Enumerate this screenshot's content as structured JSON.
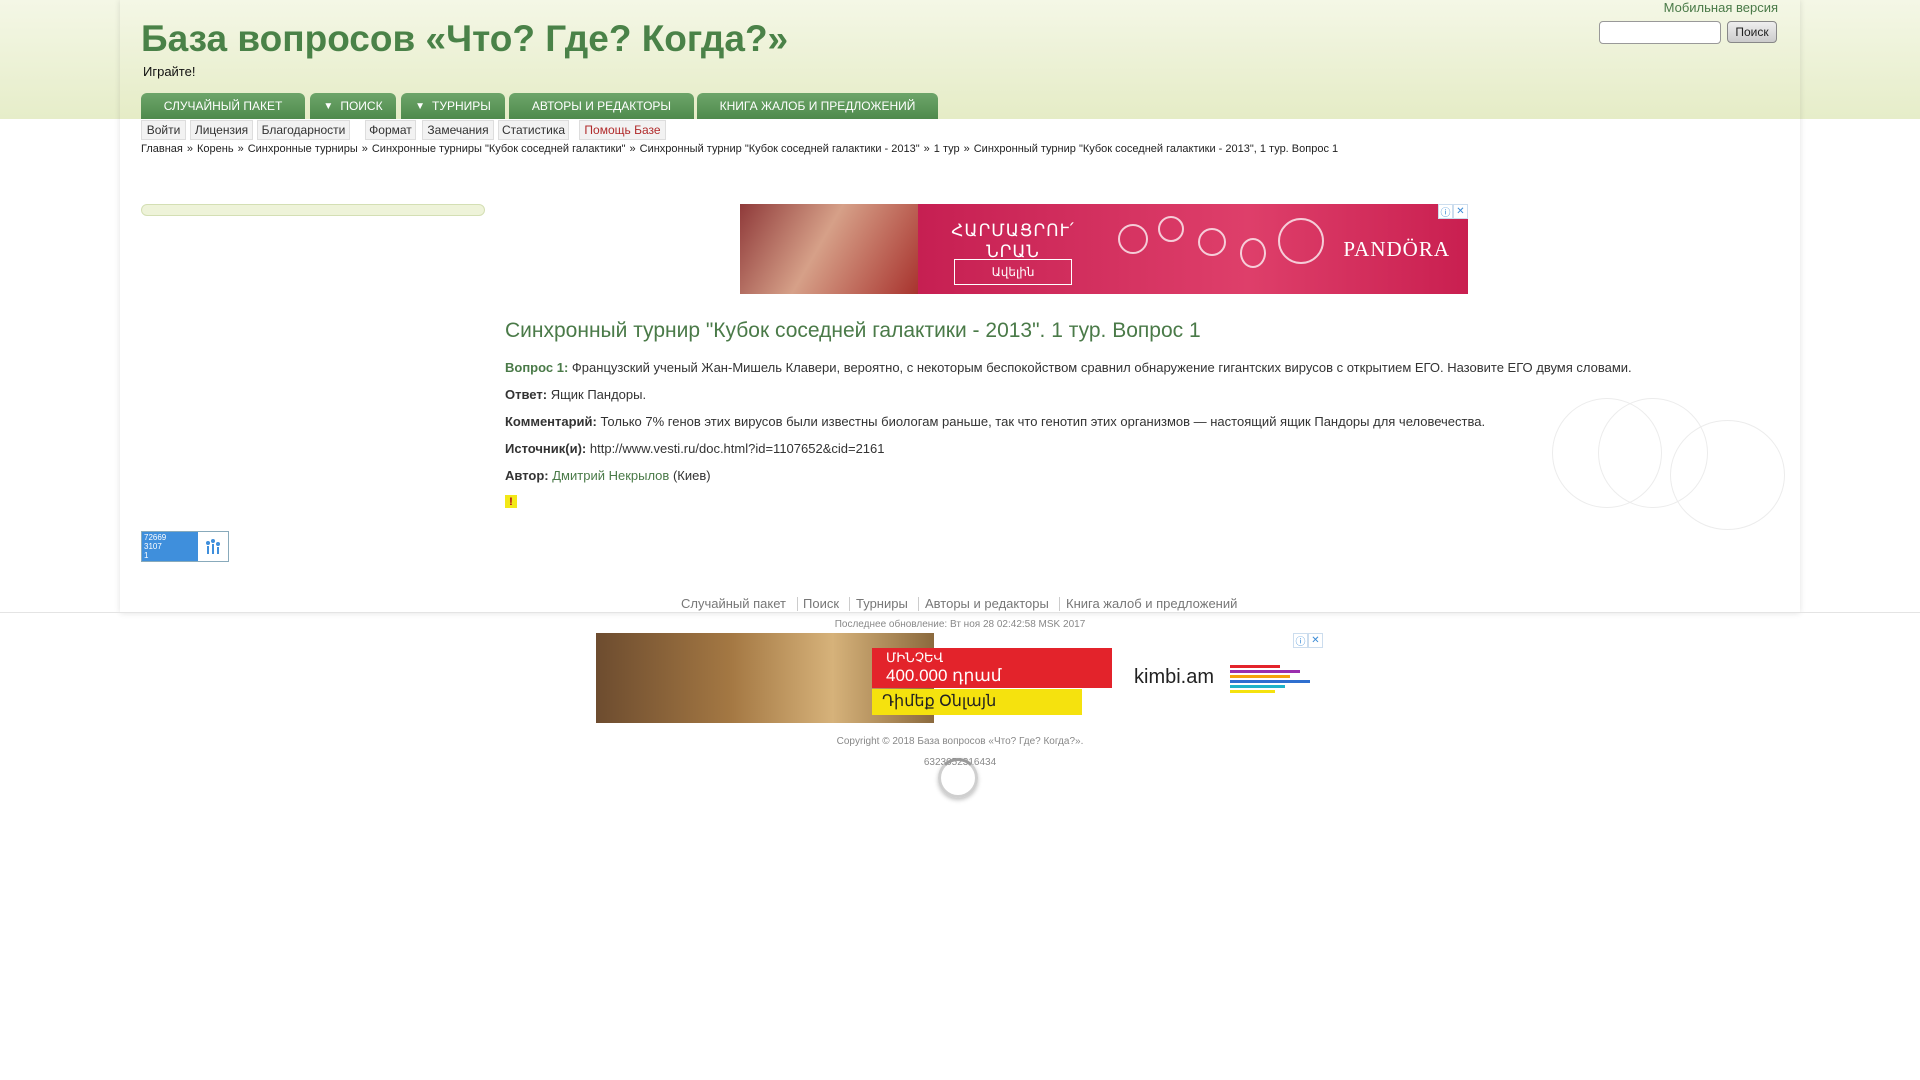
{
  "header": {
    "title": "База вопросов «Что? Где? Когда?»",
    "tagline": "Играйте!",
    "mobile_link": "Мобильная версия",
    "search_button": "Поиск",
    "search_value": ""
  },
  "main_nav": [
    {
      "label": "Случайный пакет"
    },
    {
      "label": "Поиск",
      "arrow": "▼"
    },
    {
      "label": "Турниры",
      "arrow": "▼"
    },
    {
      "label": "Авторы и редакторы"
    },
    {
      "label": "Книга жалоб и предложений"
    }
  ],
  "sub_nav": [
    "Войти",
    "Лицензия",
    "Благодарности",
    "Формат",
    "Замечания",
    "Статистика",
    "Помощь Базе"
  ],
  "breadcrumb": [
    "Главная",
    "Корень",
    "Синхронные турниры",
    "Синхронные турниры \"Кубок соседней галактики\"",
    "Синхронный турнир \"Кубок соседней галактики - 2013\"",
    "1 тур",
    "Синхронный турнир \"Кубок соседней галактики - 2013\", 1 тур. Вопрос 1"
  ],
  "breadcrumb_sep": "»",
  "ad_top": {
    "text_line1": "ՀԱՐՄԱՑՐՈՒ՛",
    "text_line2": "ՆՐԱՆ",
    "button": "Ավելին",
    "brand": "PANDÖRA",
    "info_icon": "info-icon",
    "close_icon": "close-icon"
  },
  "question": {
    "title": "Синхронный турнир \"Кубок соседней галактики - 2013\". 1 тур. Вопрос 1",
    "number_label": "Вопрос 1:",
    "text": "Французский ученый Жан-Мишель Клавери, вероятно, с некоторым беспокойством сравнил обнаружение гигантских вирусов с открытием ЕГО. Назовите ЕГО двумя словами.",
    "answer_label": "Ответ:",
    "answer": "Ящик Пандоры.",
    "comment_label": "Комментарий:",
    "comment": "Только 7% генов этих вирусов были известны биологам раньше, так что генотип этих организмов — настоящий ящик Пандоры для человечества.",
    "source_label": "Источник(и):",
    "source": "http://www.vesti.ru/doc.html?id=1107652&cid=2161",
    "author_label": "Автор:",
    "author": "Дмитрий Некрылов",
    "author_city": "(Киев)",
    "flag": "!"
  },
  "counter": {
    "line1": "72669",
    "line2": "3107",
    "line3": "1"
  },
  "footer": {
    "links": [
      "Случайный пакет",
      "Поиск",
      "Турниры",
      "Авторы и редакторы",
      "Книга жалоб и предложений"
    ],
    "updated": "Последнее обновление: Вт ноя 28 02:42:58 MSK 2017",
    "copyright": "Copyright © 2018 База вопросов «Что? Где? Когда?».",
    "hash": "6323052316434"
  },
  "ad_bottom": {
    "line1": "ՄԻՆՉԵՎ",
    "line2": "400.000 դրամ",
    "line3": "Դիմեք Օնլայն",
    "logo": "kimbi.am"
  },
  "colors": {
    "brand_green": "#4a8248",
    "link_green": "#4a7a48",
    "nav_green": "#5f9a5c",
    "help_red": "#b02a2a",
    "counter_blue": "#3f8fdc"
  }
}
